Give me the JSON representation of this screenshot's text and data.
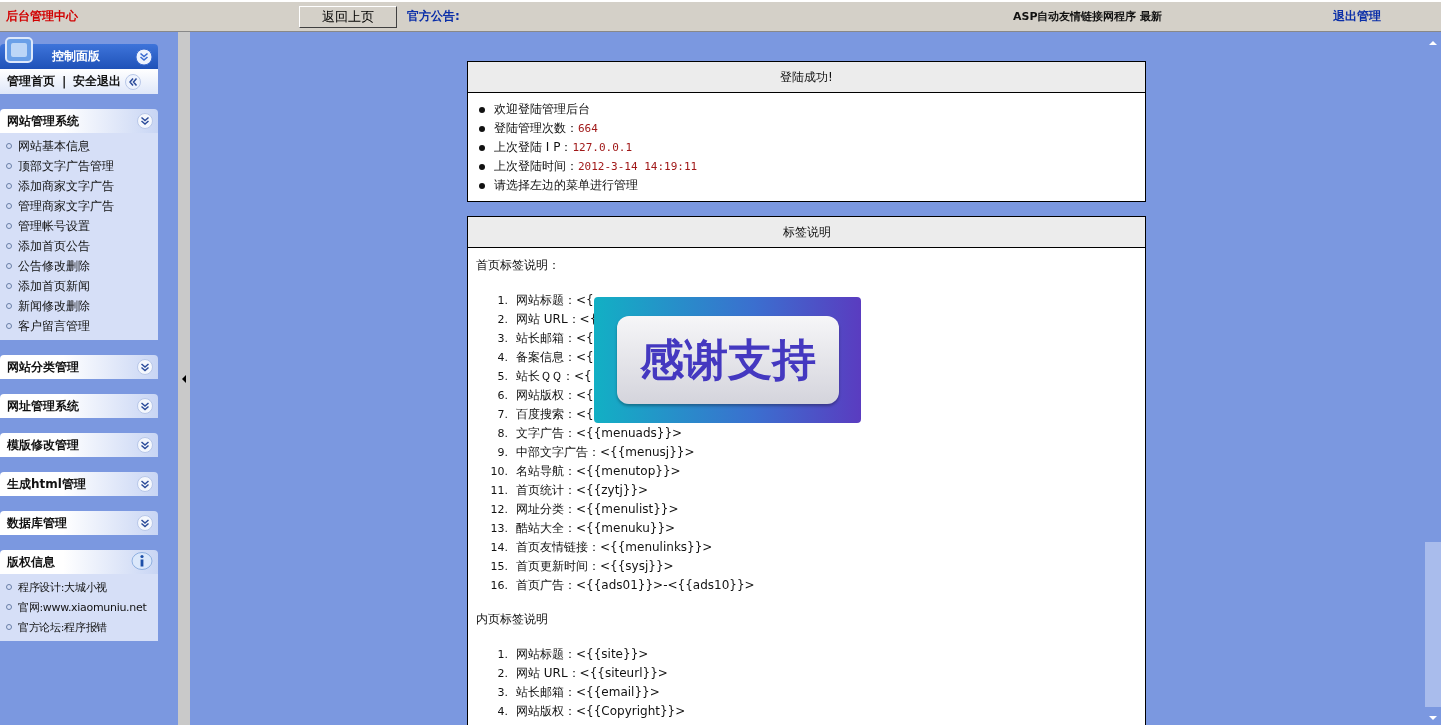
{
  "top_bar": {
    "title": "后台管理中心",
    "back_button": "返回上页",
    "notice_label": "官方公告:",
    "notice_text": "ASP自动友情链接网程序 最新",
    "logout": "退出管理"
  },
  "sidebar": {
    "control_panel": {
      "title": "控制面版",
      "links": [
        "管理首页",
        "安全退出"
      ],
      "separator": "|"
    },
    "sections": [
      {
        "title": "网站管理系统",
        "expanded": true,
        "items": [
          "网站基本信息",
          "顶部文字广告管理",
          "添加商家文字广告",
          "管理商家文字广告",
          "管理帐号设置",
          "添加首页公告",
          "公告修改删除",
          "添加首页新闻",
          "新闻修改删除",
          "客户留言管理"
        ]
      },
      {
        "title": "网站分类管理",
        "expanded": false
      },
      {
        "title": "网址管理系统",
        "expanded": false
      },
      {
        "title": "模版修改管理",
        "expanded": false
      },
      {
        "title": "生成html管理",
        "expanded": false
      },
      {
        "title": "数据库管理",
        "expanded": false
      }
    ],
    "copyright": {
      "title": "版权信息",
      "items": [
        "程序设计:大城小视",
        "官网:www.xiaomuniu.net",
        "官方论坛:程序报错"
      ]
    }
  },
  "login_panel": {
    "title": "登陆成功!",
    "items": [
      {
        "label": "欢迎登陆管理后台"
      },
      {
        "label": "登陆管理次数：",
        "value": "664"
      },
      {
        "label": "上次登陆 I P：",
        "value": "127.0.0.1"
      },
      {
        "label": "上次登陆时间：",
        "value": "2012-3-14 14:19:11"
      },
      {
        "label": "请选择左边的菜单进行管理"
      }
    ]
  },
  "tags_panel": {
    "title": "标签说明",
    "home_heading": "首页标签说明：",
    "home_items": [
      {
        "number": "1.",
        "text": "网站标题：<{"
      },
      {
        "number": "2.",
        "text": "网站 URL：<{"
      },
      {
        "number": "3.",
        "text": "站长邮箱：<{"
      },
      {
        "number": "4.",
        "text": "备案信息：<{"
      },
      {
        "number": "5.",
        "text": "站长ＱＱ：<{"
      },
      {
        "number": "6.",
        "text": "网站版权：<{"
      },
      {
        "number": "7.",
        "text": "百度搜索：<{"
      },
      {
        "number": "8.",
        "text": "文字广告：<{{menuads}}>"
      },
      {
        "number": "9.",
        "text": "中部文字广告：<{{menusj}}>"
      },
      {
        "number": "10.",
        "text": "名站导航：<{{menutop}}>"
      },
      {
        "number": "11.",
        "text": "首页统计：<{{zytj}}>"
      },
      {
        "number": "12.",
        "text": "网址分类：<{{menulist}}>"
      },
      {
        "number": "13.",
        "text": "酷站大全：<{{menuku}}>"
      },
      {
        "number": "14.",
        "text": "首页友情链接：<{{menulinks}}>"
      },
      {
        "number": "15.",
        "text": "首页更新时间：<{{sysj}}>"
      },
      {
        "number": "16.",
        "text": "首页广告：<{{ads01}}>-<{{ads10}}>"
      }
    ],
    "inner_heading": "内页标签说明",
    "inner_items": [
      {
        "number": "1.",
        "text": "网站标题：<{{site}}>"
      },
      {
        "number": "2.",
        "text": "网站 URL：<{{siteurl}}>"
      },
      {
        "number": "3.",
        "text": "站长邮箱：<{{email}}>"
      },
      {
        "number": "4.",
        "text": "网站版权：<{{Copyright}}>"
      }
    ]
  },
  "overlay": {
    "text": "感谢支持"
  }
}
